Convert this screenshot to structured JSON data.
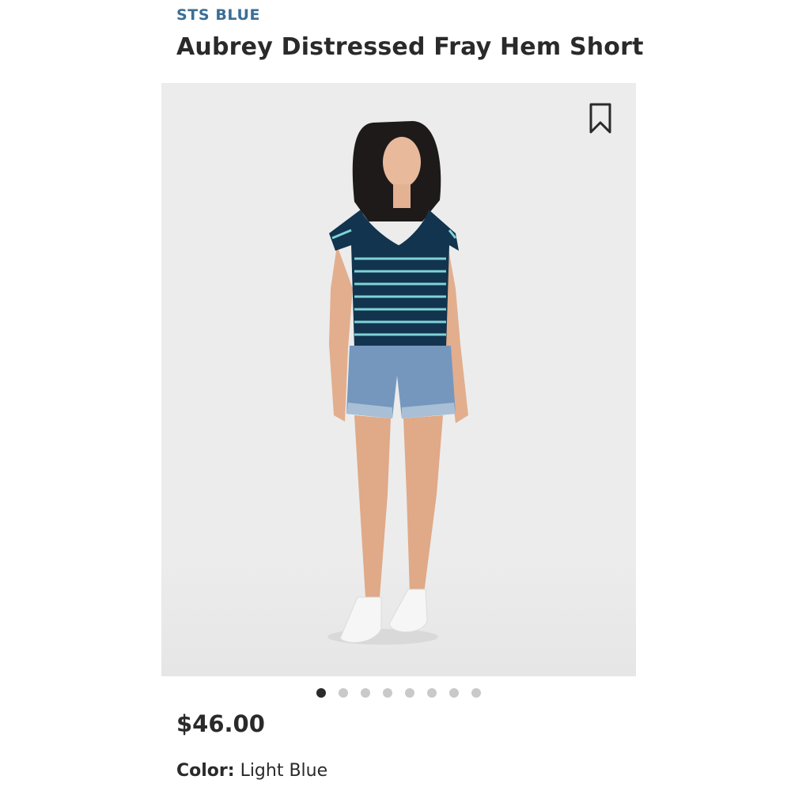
{
  "product": {
    "brand": "STS BLUE",
    "title": "Aubrey Distressed Fray Hem Short",
    "price": "$46.00",
    "color_label": "Color:",
    "color_value": "Light Blue"
  },
  "gallery": {
    "image_count": 8,
    "active_index": 0,
    "bookmark_icon": "bookmark-icon"
  },
  "colors": {
    "brand": "#3b6e96",
    "text": "#2a2a2a",
    "dot_active": "#2b2b2b",
    "dot_inactive": "#c9c9c9"
  }
}
